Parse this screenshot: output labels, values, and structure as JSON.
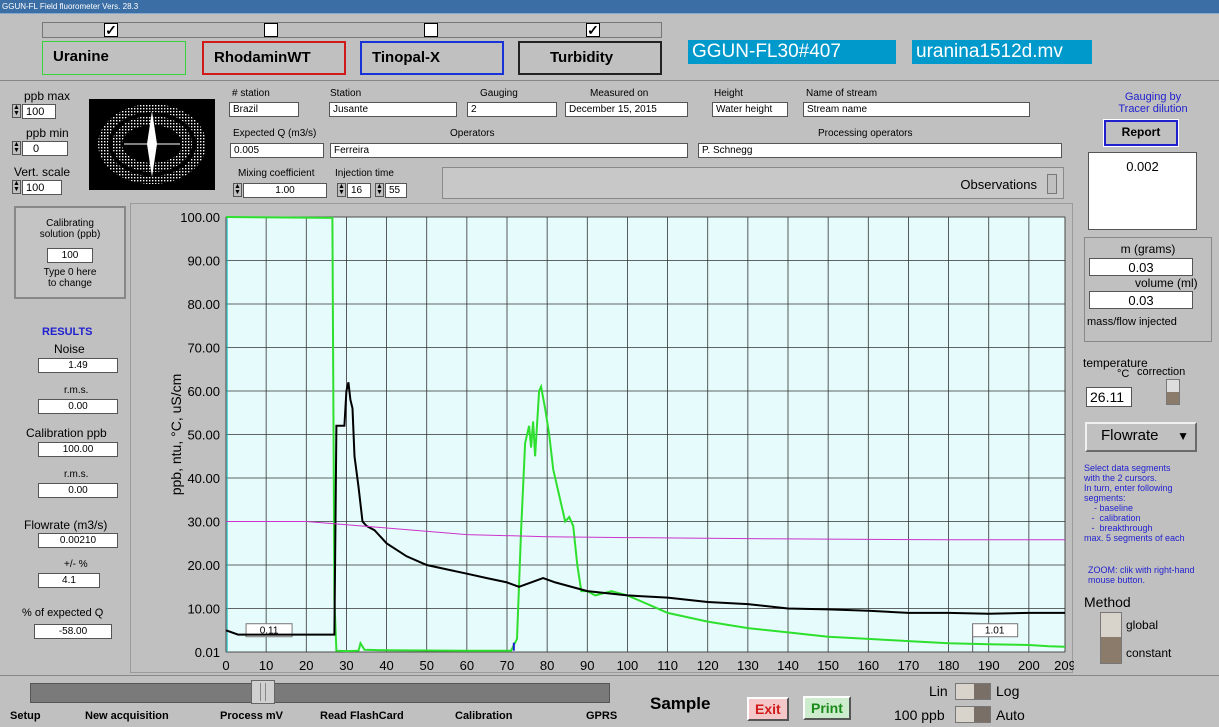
{
  "window_title": "GGUN-FL Field fluorometer Vers. 28.3",
  "channels": [
    {
      "name": "Uranine",
      "checked": true,
      "color": "#36d43b"
    },
    {
      "name": "RhodaminWT",
      "checked": false,
      "color": "#d01a1a"
    },
    {
      "name": "Tinopal-X",
      "checked": false,
      "color": "#1733d8"
    },
    {
      "name": "Turbidity",
      "checked": true,
      "color": "#000000"
    }
  ],
  "device_id": "GGUN-FL30#407",
  "file_name": "uranina1512d.mv",
  "scale": {
    "ppb_max_label": "ppb max",
    "ppb_max": "100",
    "ppb_min_label": "ppb min",
    "ppb_min": "0",
    "vert_label": "Vert. scale",
    "vert": "100"
  },
  "header": {
    "station_no_label": "# station",
    "station_no": "Brazil",
    "station_label": "Station",
    "station": "Jusante",
    "gauging_label": "Gauging",
    "gauging": "2",
    "measured_label": "Measured on",
    "measured": "December 15, 2015",
    "height_label": "Height",
    "height": "Water height",
    "stream_label": "Name of stream",
    "stream": "Stream name",
    "expected_q_label": "Expected Q (m3/s)",
    "expected_q": "0.005",
    "operators_label": "Operators",
    "operators": "Ferreira",
    "proc_label": "Processing operators",
    "proc": "P. Schnegg",
    "mixing_label": "Mixing coefficient",
    "mixing": "1.00",
    "inj_label": "Injection time",
    "inj_h": "16",
    "inj_m": "55",
    "observations": "Observations"
  },
  "calib": {
    "title1": "Calibrating",
    "title2": "solution (ppb)",
    "value": "100",
    "hint1": "Type 0  here",
    "hint2": "to change"
  },
  "results": {
    "title": "RESULTS",
    "noise_label": "Noise",
    "noise": "1.49",
    "rms_label": "r.m.s.",
    "rms1": "0.00",
    "calib_label": "Calibration ppb",
    "calib": "100.00",
    "rms2": "0.00",
    "flow_label": "Flowrate (m3/s)",
    "flow": "0.00210",
    "pm_label": "+/- %",
    "pm": "4.1",
    "exp_label": "% of expected Q",
    "exp": "-58.00"
  },
  "right": {
    "gauging_title1": "Gauging by",
    "gauging_title2": "Tracer dilution",
    "report": "Report",
    "report_value": "0.002",
    "m_label": "m (grams)",
    "m": "0.03",
    "vol_label": "volume (ml)",
    "vol": "0.03",
    "mass_label": "mass/flow injected",
    "temp_label": "temperature",
    "temp_unit": "°C",
    "temp_corr": "correction",
    "temp": "26.11",
    "flowrate_menu": "Flowrate",
    "instr": [
      "Select data segments",
      "with the 2 cursors.",
      "In turn, enter following",
      "segments:",
      "    - baseline",
      "   -  calibration",
      "   -  breakthrough",
      "max. 5 segments of each"
    ],
    "zoom": [
      "ZOOM: clik with right-hand",
      "mouse button."
    ],
    "method_label": "Method",
    "method_global": "global",
    "method_constant": "constant"
  },
  "bottom": {
    "setup": "Setup",
    "new_acq": "New acquisition",
    "process": "Process mV",
    "read": "Read FlashCard",
    "calibration": "Calibration",
    "gprs": "GPRS",
    "sample": "Sample",
    "exit": "Exit",
    "print": "Print",
    "lin": "Lin",
    "log": "Log",
    "ppb100": "100 ppb",
    "auto": "Auto"
  },
  "chart_data": {
    "type": "line",
    "ylabel": "ppb, ntu, °C, uS/cm",
    "xlim": [
      0,
      209
    ],
    "ylim": [
      0,
      100
    ],
    "x_ticks": [
      "0",
      "10",
      "20",
      "30",
      "40",
      "50",
      "60",
      "70",
      "80",
      "90",
      "100",
      "110",
      "120",
      "130",
      "140",
      "150",
      "160",
      "170",
      "180",
      "190",
      "200",
      "209"
    ],
    "y_ticks": [
      "0.01",
      "10.00",
      "20.00",
      "30.00",
      "40.00",
      "50.00",
      "60.00",
      "70.00",
      "80.00",
      "90.00",
      "100.00"
    ],
    "cursor_left": "0.11",
    "cursor_right": "1.01",
    "background": "#e6fbfb",
    "series": [
      {
        "color": "#2ee02e",
        "points": [
          [
            0,
            100
          ],
          [
            26.5,
            99.8
          ],
          [
            27,
            12
          ],
          [
            27.5,
            0.3
          ],
          [
            30,
            0.2
          ],
          [
            33,
            0.3
          ],
          [
            33.5,
            2
          ],
          [
            34.5,
            0.5
          ],
          [
            40,
            0.4
          ],
          [
            60,
            0.3
          ],
          [
            71,
            0.3
          ],
          [
            72.5,
            3
          ],
          [
            73.5,
            28
          ],
          [
            74.5,
            48
          ],
          [
            75.5,
            52
          ],
          [
            76,
            47
          ],
          [
            76.5,
            53
          ],
          [
            77,
            45
          ],
          [
            78,
            60
          ],
          [
            78.5,
            61
          ],
          [
            79.5,
            56
          ],
          [
            80.5,
            50
          ],
          [
            81.5,
            42
          ],
          [
            82.5,
            38
          ],
          [
            83.5,
            34
          ],
          [
            84.5,
            30
          ],
          [
            85.5,
            31
          ],
          [
            86.5,
            29
          ],
          [
            87.5,
            20
          ],
          [
            88.5,
            14
          ],
          [
            90,
            14
          ],
          [
            92,
            13
          ],
          [
            94,
            13.5
          ],
          [
            96,
            14
          ],
          [
            100,
            13
          ],
          [
            105,
            11
          ],
          [
            110,
            9
          ],
          [
            120,
            7
          ],
          [
            130,
            5.5
          ],
          [
            140,
            4.5
          ],
          [
            150,
            3.5
          ],
          [
            160,
            3
          ],
          [
            170,
            2.5
          ],
          [
            180,
            2
          ],
          [
            190,
            1.8
          ],
          [
            200,
            1.6
          ],
          [
            205,
            1.3
          ],
          [
            209,
            1.2
          ]
        ]
      },
      {
        "color": "#000000",
        "points": [
          [
            0,
            5
          ],
          [
            3,
            4
          ],
          [
            27,
            4
          ],
          [
            27.5,
            52
          ],
          [
            29.5,
            52
          ],
          [
            30,
            60
          ],
          [
            30.5,
            62
          ],
          [
            31,
            58
          ],
          [
            31.5,
            56
          ],
          [
            32,
            45
          ],
          [
            33,
            38
          ],
          [
            34,
            30
          ],
          [
            35,
            29
          ],
          [
            37,
            28
          ],
          [
            40,
            25
          ],
          [
            45,
            22
          ],
          [
            50,
            20
          ],
          [
            55,
            19
          ],
          [
            60,
            18
          ],
          [
            65,
            17
          ],
          [
            70,
            16
          ],
          [
            73,
            15
          ],
          [
            76,
            16
          ],
          [
            79,
            17
          ],
          [
            82,
            16
          ],
          [
            90,
            14
          ],
          [
            100,
            13
          ],
          [
            110,
            12.5
          ],
          [
            120,
            11.5
          ],
          [
            130,
            11
          ],
          [
            140,
            10
          ],
          [
            150,
            9.8
          ],
          [
            160,
            9.5
          ],
          [
            170,
            9
          ],
          [
            180,
            9
          ],
          [
            190,
            8.8
          ],
          [
            200,
            9
          ],
          [
            209,
            9
          ]
        ]
      },
      {
        "color": "#cc33cc",
        "points": [
          [
            0,
            30
          ],
          [
            20,
            30
          ],
          [
            40,
            28.5
          ],
          [
            60,
            27
          ],
          [
            80,
            26.5
          ],
          [
            100,
            26.3
          ],
          [
            140,
            26
          ],
          [
            180,
            25.8
          ],
          [
            209,
            25.8
          ]
        ]
      }
    ]
  }
}
